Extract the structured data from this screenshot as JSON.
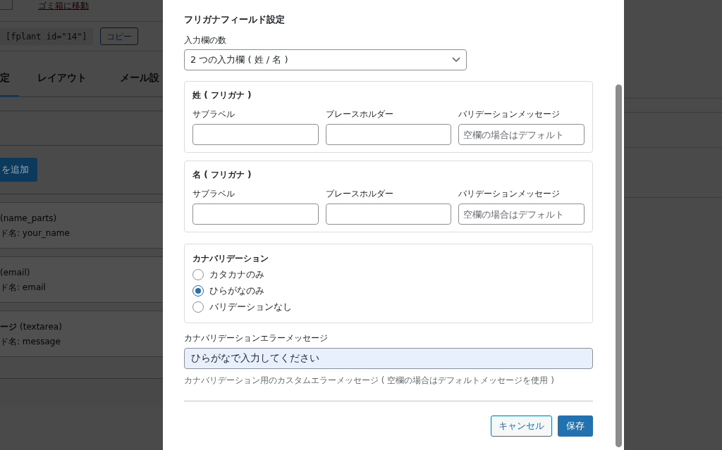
{
  "background": {
    "trash_link": "ゴミ箱に移動",
    "shortcode": "[fplant id=\"14\"]",
    "copy_button": "コピー",
    "tabs": [
      {
        "label": "定",
        "selected": true
      },
      {
        "label": "レイアウト",
        "selected": false
      },
      {
        "label": "メール設",
        "selected": false
      }
    ],
    "add_button": "を追加",
    "fields": [
      {
        "type": "(name_parts)",
        "field_name": "ド名: your_name"
      },
      {
        "type": "(email)",
        "field_name": "ド名: email"
      },
      {
        "name": "ージ",
        "type": "(textarea)",
        "field_name": "ド名: message"
      }
    ]
  },
  "modal": {
    "title": "フリガナフィールド設定",
    "count_label": "入力欄の数",
    "count_select": "2 つの入力欄 ( 姓 / 名 )",
    "groups": [
      {
        "title": "姓 ( フリガナ )",
        "columns": [
          {
            "label": "サブラベル"
          },
          {
            "label": "プレースホルダー"
          },
          {
            "label": "バリデーションメッセージ",
            "placeholder": "空欄の場合はデフォルト"
          }
        ]
      },
      {
        "title": "名 ( フリガナ )",
        "columns": [
          {
            "label": "サブラベル"
          },
          {
            "label": "プレースホルダー"
          },
          {
            "label": "バリデーションメッセージ",
            "placeholder": "空欄の場合はデフォルト"
          }
        ]
      }
    ],
    "kana_validation": {
      "title": "カナバリデーション",
      "options": [
        {
          "label": "カタカナのみ",
          "selected": false
        },
        {
          "label": "ひらがなのみ",
          "selected": true
        },
        {
          "label": "バリデーションなし",
          "selected": false
        }
      ]
    },
    "error_label": "カナバリデーションエラーメッセージ",
    "error_value": "ひらがなで入力してください",
    "error_help": "カナバリデーション用のカスタムエラーメッセージ ( 空欄の場合はデフォルトメッセージを使用 )",
    "buttons": {
      "cancel": "キャンセル",
      "save": "保存"
    }
  }
}
